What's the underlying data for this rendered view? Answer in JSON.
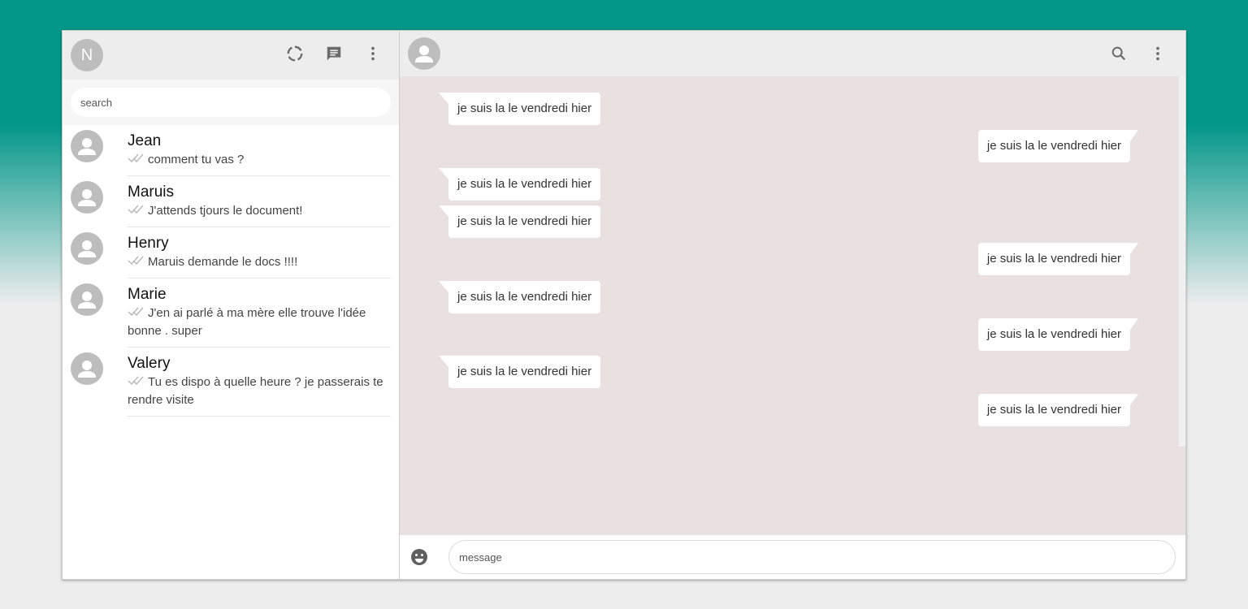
{
  "sidebar": {
    "user_initial": "N",
    "icons": [
      "status-icon",
      "new-chat-icon",
      "more-vert-icon"
    ],
    "search": {
      "placeholder": "search",
      "value": ""
    },
    "contacts": [
      {
        "name": "Jean",
        "last_message": "comment tu vas ?"
      },
      {
        "name": "Maruis",
        "last_message": "J'attends tjours le document!"
      },
      {
        "name": "Henry",
        "last_message": "Maruis demande le docs !!!!"
      },
      {
        "name": "Marie",
        "last_message": "J'en ai parlé à ma mère elle trouve l'idée bonne . super"
      },
      {
        "name": "Valery",
        "last_message": "Tu es dispo à quelle heure ? je passerais te rendre visite"
      }
    ]
  },
  "chat": {
    "header_icons": [
      "search-icon",
      "more-vert-icon"
    ],
    "messages": [
      {
        "direction": "in",
        "text": "je suis la le vendredi hier"
      },
      {
        "direction": "out",
        "text": "je suis la le vendredi hier"
      },
      {
        "direction": "in",
        "text": "je suis la le vendredi hier"
      },
      {
        "direction": "in",
        "text": "je suis la le vendredi hier"
      },
      {
        "direction": "out",
        "text": "je suis la le vendredi hier"
      },
      {
        "direction": "in",
        "text": "je suis la le vendredi hier"
      },
      {
        "direction": "out",
        "text": "je suis la le vendredi hier"
      },
      {
        "direction": "in",
        "text": "je suis la le vendredi hier"
      },
      {
        "direction": "out",
        "text": "je suis la le vendredi hier"
      }
    ],
    "composer": {
      "placeholder": "message",
      "value": ""
    }
  },
  "colors": {
    "accent": "#009688",
    "chat_background": "#e8e1e0",
    "header_background": "#ededed",
    "avatar": "#bdbdbd"
  }
}
